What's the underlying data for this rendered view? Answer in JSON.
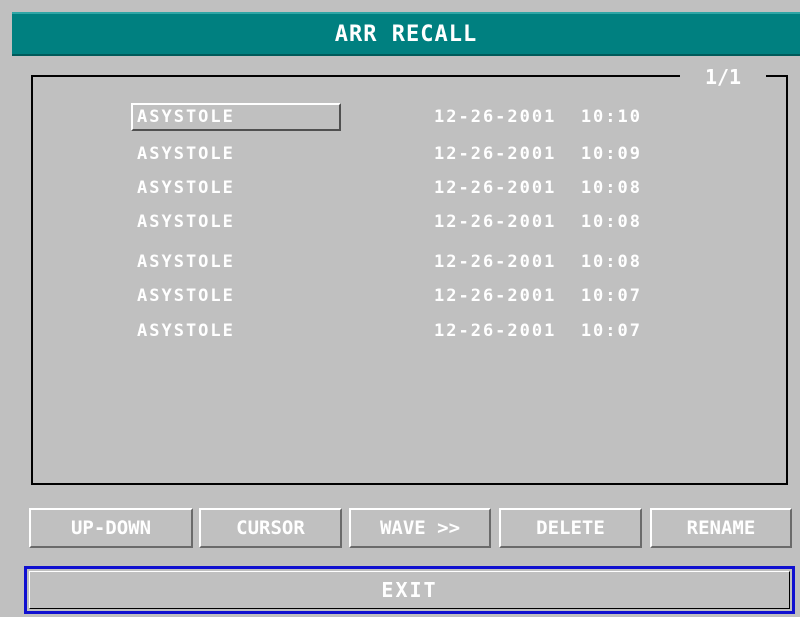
{
  "window": {
    "title": "ARR RECALL",
    "page": "1/1"
  },
  "events": [
    {
      "name": "ASYSTOLE",
      "time": "12-26-2001  10:10",
      "selected": true
    },
    {
      "name": "ASYSTOLE",
      "time": "12-26-2001  10:09",
      "selected": false
    },
    {
      "name": "ASYSTOLE",
      "time": "12-26-2001  10:08",
      "selected": false
    },
    {
      "name": "ASYSTOLE",
      "time": "12-26-2001  10:08",
      "selected": false
    },
    {
      "name": "ASYSTOLE",
      "time": "12-26-2001  10:08",
      "selected": false
    },
    {
      "name": "ASYSTOLE",
      "time": "12-26-2001  10:07",
      "selected": false
    },
    {
      "name": "ASYSTOLE",
      "time": "12-26-2001  10:07",
      "selected": false
    }
  ],
  "buttons": {
    "up_down": "UP-DOWN",
    "cursor": "CURSOR",
    "wave": "WAVE >>",
    "delete": "DELETE",
    "rename": "RENAME",
    "exit": "EXIT"
  },
  "colors": {
    "title_bar": "#008080",
    "background": "#c0c0c0",
    "text": "#ffffff",
    "exit_border": "#1010d0"
  }
}
